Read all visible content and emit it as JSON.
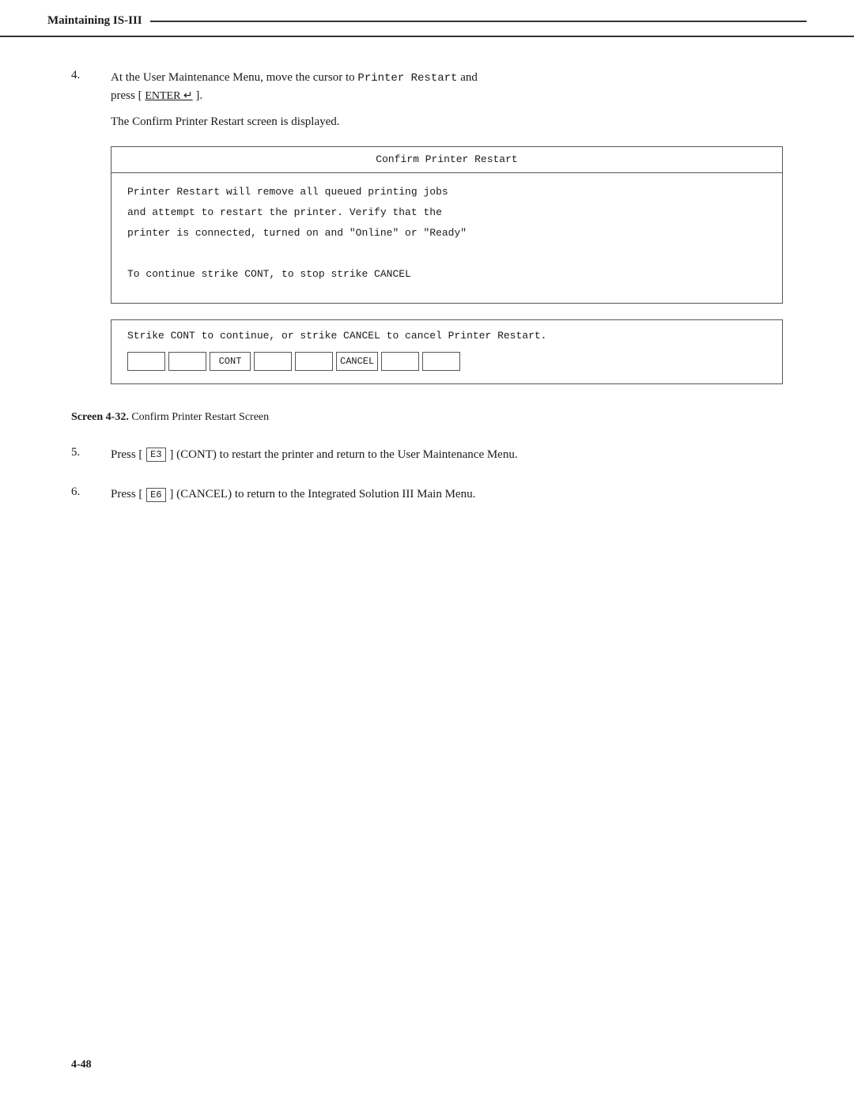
{
  "header": {
    "title": "Maintaining IS-III"
  },
  "step4": {
    "number": "4.",
    "text_before_mono": "At the User Maintenance Menu, move the cursor to ",
    "mono_text": "Printer Restart",
    "text_after_mono": " and",
    "text_line2": "press [ ",
    "key_label": "ENTER ↵",
    "text_line2_end": " ].",
    "confirm_text": "The Confirm Printer Restart screen is displayed."
  },
  "screen": {
    "title": "Confirm Printer Restart",
    "body_line1": "Printer Restart will remove all queued printing jobs",
    "body_line2": "and attempt to restart the printer. Verify that the",
    "body_line3": "printer is connected, turned on and \"Online\" or \"Ready\"",
    "body_line4": "",
    "body_line5": "To continue strike CONT, to stop strike CANCEL",
    "status_line": "Strike CONT to continue, or strike CANCEL to cancel Printer Restart.",
    "fkeys": [
      {
        "label": "",
        "id": "f1"
      },
      {
        "label": "",
        "id": "f2"
      },
      {
        "label": "CONT",
        "id": "f3"
      },
      {
        "label": "",
        "id": "f4"
      },
      {
        "label": "",
        "id": "f5"
      },
      {
        "label": "CANCEL",
        "id": "f6"
      },
      {
        "label": "",
        "id": "f7"
      },
      {
        "label": "",
        "id": "f8"
      }
    ]
  },
  "caption": {
    "bold_part": "Screen 4-32.",
    "text": " Confirm Printer Restart Screen"
  },
  "step5": {
    "number": "5.",
    "key_ref": "F3",
    "key_label": "E3",
    "text": "Press [ E3 ] (CONT) to restart the printer and return to the User Maintenance Menu."
  },
  "step6": {
    "number": "6.",
    "key_ref": "F6",
    "key_label": "E6",
    "text": "Press [ E6 ] (CANCEL) to return to the Integrated Solution III Main Menu."
  },
  "footer": {
    "page": "4-48"
  }
}
